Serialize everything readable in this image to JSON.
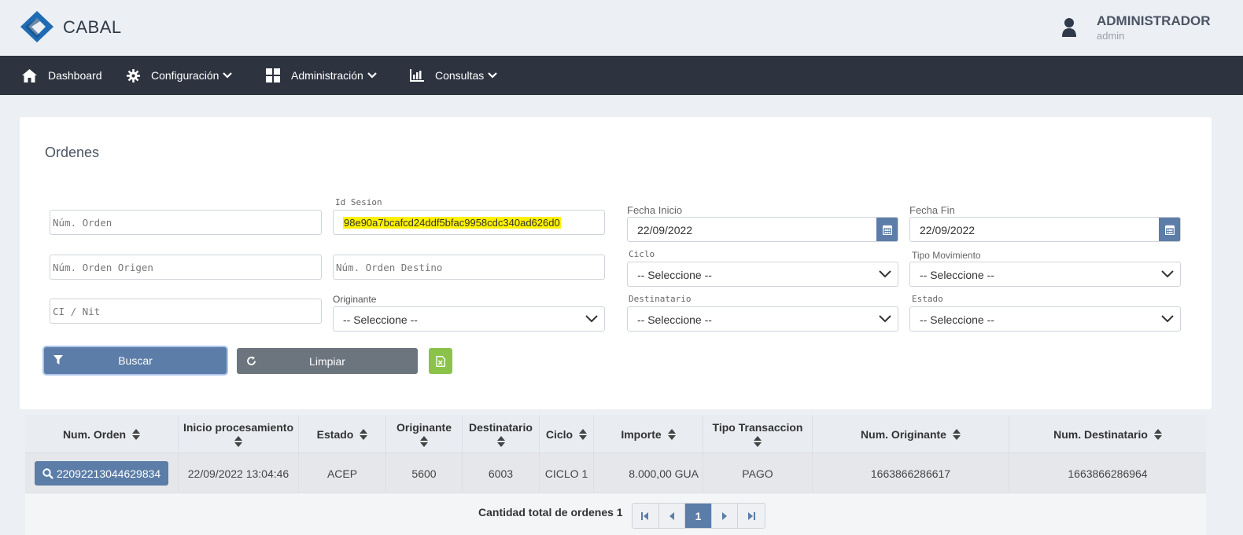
{
  "header": {
    "brand": "CABAL",
    "user_name": "ADMINISTRADOR",
    "user_login": "admin"
  },
  "nav": {
    "items": [
      {
        "label": "Dashboard",
        "icon": "home-icon"
      },
      {
        "label": "Configuración",
        "icon": "gear-icon"
      },
      {
        "label": "Administración",
        "icon": "grid-icon"
      },
      {
        "label": "Consultas",
        "icon": "bar-chart-icon"
      }
    ]
  },
  "page": {
    "title": "Ordenes"
  },
  "filters": {
    "num_orden": {
      "placeholder": "Núm. Orden",
      "value": ""
    },
    "id_sesion": {
      "label": "Id Sesion",
      "value": "98e90a7bcafcd24ddf5bfac9958cdc340ad626d0"
    },
    "fecha_inicio": {
      "label": "Fecha Inicio",
      "value": "22/09/2022"
    },
    "fecha_fin": {
      "label": "Fecha Fin",
      "value": "22/09/2022"
    },
    "num_orden_origen": {
      "placeholder": "Núm. Orden Origen",
      "value": ""
    },
    "num_orden_destino": {
      "placeholder": "Núm. Orden Destino",
      "value": ""
    },
    "ciclo": {
      "label": "Ciclo",
      "value": "-- Seleccione --"
    },
    "tipo_movimiento": {
      "label": "Tipo Movimiento",
      "value": "-- Seleccione --"
    },
    "ci_nit": {
      "placeholder": "CI / Nit",
      "value": ""
    },
    "originante": {
      "label": "Originante",
      "value": "-- Seleccione --"
    },
    "destinatario": {
      "label": "Destinatario",
      "value": "-- Seleccione --"
    },
    "estado": {
      "label": "Estado",
      "value": "-- Seleccione --"
    }
  },
  "actions": {
    "buscar": "Buscar",
    "limpiar": "Limpiar",
    "excel_icon": "excel-file-icon"
  },
  "table": {
    "columns": [
      "Num. Orden",
      "Inicio procesamiento",
      "Estado",
      "Originante",
      "Destinatario",
      "Ciclo",
      "Importe",
      "Tipo Transaccion",
      "Num. Originante",
      "Num. Destinatario"
    ],
    "rows": [
      {
        "num_orden": "22092213044629834",
        "inicio": "22/09/2022 13:04:46",
        "estado": "ACEP",
        "originante": "5600",
        "destinatario": "6003",
        "ciclo": "CICLO 1",
        "importe": "8.000,00 GUA",
        "tipo": "PAGO",
        "num_originante": "1663866286617",
        "num_destinatario": "1663866286964"
      }
    ]
  },
  "pagination": {
    "total_label": "Cantidad total de ordenes 1",
    "current_page": "1"
  },
  "colors": {
    "primary": "#5b7da7",
    "navbar": "#2d3440",
    "secondary": "#6c757d",
    "excel": "#8bc34a",
    "highlight": "#fff200"
  }
}
